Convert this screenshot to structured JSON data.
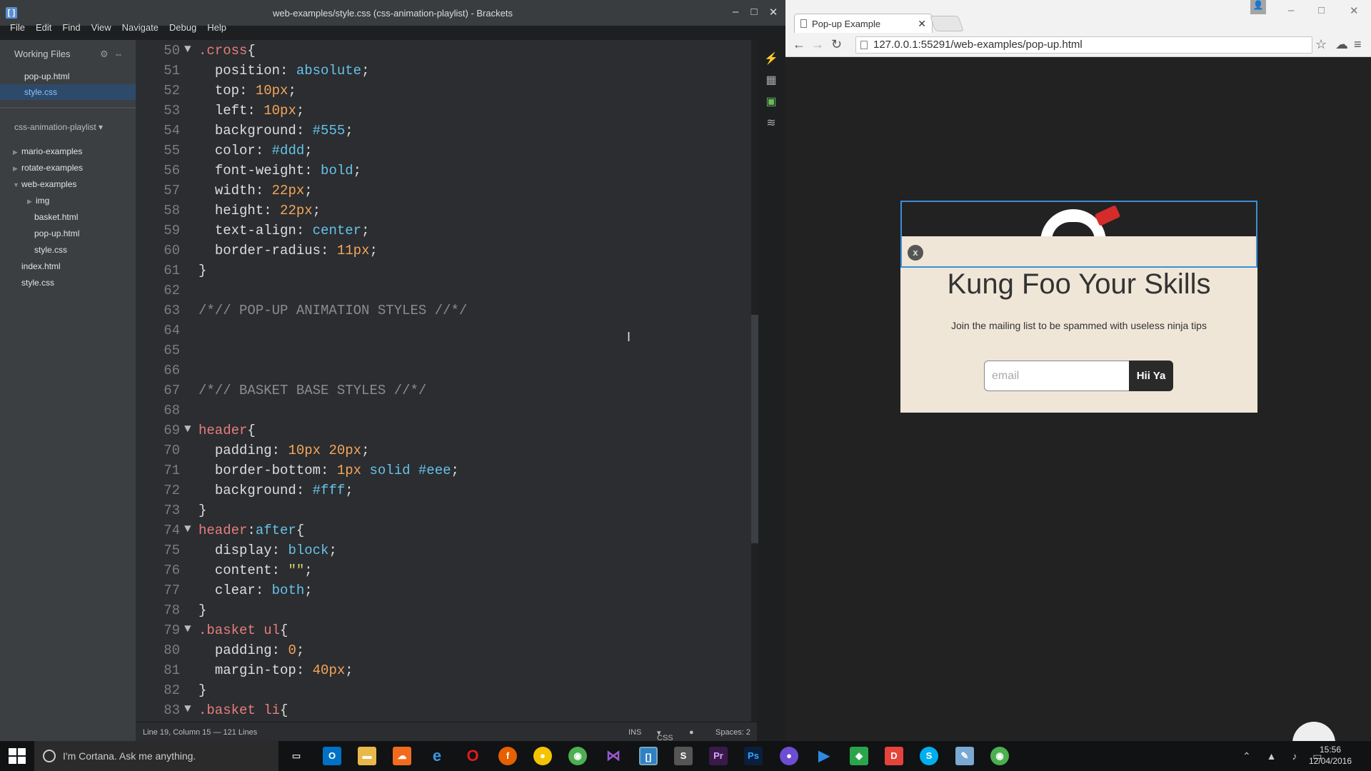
{
  "brackets": {
    "title": "web-examples/style.css (css-animation-playlist) - Brackets",
    "menu": [
      "File",
      "Edit",
      "Find",
      "View",
      "Navigate",
      "Debug",
      "Help"
    ],
    "working_files_title": "Working Files",
    "working_files": [
      "pop-up.html",
      "style.css"
    ],
    "project_title": "css-animation-playlist",
    "tree": [
      "mario-examples",
      "rotate-examples",
      "web-examples",
      "img",
      "basket.html",
      "pop-up.html",
      "style.css",
      "index.html",
      "style.css"
    ],
    "code_lines": [
      {
        "n": "50",
        "fold": "▼",
        "html": "<span class='sel-c'>.cross</span>{"
      },
      {
        "n": "51",
        "html": "  <span class='prop'>position</span>: <span class='val'>absolute</span>;"
      },
      {
        "n": "52",
        "html": "  <span class='prop'>top</span>: <span class='num'>10px</span>;"
      },
      {
        "n": "53",
        "html": "  <span class='prop'>left</span>: <span class='num'>10px</span>;"
      },
      {
        "n": "54",
        "html": "  <span class='prop'>background</span>: <span class='hash'>#555</span>;"
      },
      {
        "n": "55",
        "html": "  <span class='prop'>color</span>: <span class='hash'>#ddd</span>;"
      },
      {
        "n": "56",
        "html": "  <span class='prop'>font-weight</span>: <span class='val'>bold</span>;"
      },
      {
        "n": "57",
        "html": "  <span class='prop'>width</span>: <span class='num'>22px</span>;"
      },
      {
        "n": "58",
        "html": "  <span class='prop'>height</span>: <span class='num'>22px</span>;"
      },
      {
        "n": "59",
        "html": "  <span class='prop'>text-align</span>: <span class='val'>center</span>;"
      },
      {
        "n": "60",
        "html": "  <span class='prop'>border-radius</span>: <span class='num'>11px</span>;"
      },
      {
        "n": "61",
        "html": "}"
      },
      {
        "n": "62",
        "html": ""
      },
      {
        "n": "63",
        "html": "<span class='cmt'>/*// POP-UP ANIMATION STYLES //*/</span>"
      },
      {
        "n": "64",
        "html": ""
      },
      {
        "n": "65",
        "html": ""
      },
      {
        "n": "66",
        "html": ""
      },
      {
        "n": "67",
        "html": "<span class='cmt'>/*// BASKET BASE STYLES //*/</span>"
      },
      {
        "n": "68",
        "html": ""
      },
      {
        "n": "69",
        "fold": "▼",
        "html": "<span class='sel-c'>header</span>{"
      },
      {
        "n": "70",
        "html": "  <span class='prop'>padding</span>: <span class='num'>10px</span> <span class='num'>20px</span>;"
      },
      {
        "n": "71",
        "html": "  <span class='prop'>border-bottom</span>: <span class='num'>1px</span> <span class='val'>solid</span> <span class='hash'>#eee</span>;"
      },
      {
        "n": "72",
        "html": "  <span class='prop'>background</span>: <span class='hash'>#fff</span>;"
      },
      {
        "n": "73",
        "html": "}"
      },
      {
        "n": "74",
        "fold": "▼",
        "html": "<span class='sel-c'>header</span>:<span class='val'>after</span>{"
      },
      {
        "n": "75",
        "html": "  <span class='prop'>display</span>: <span class='val'>block</span>;"
      },
      {
        "n": "76",
        "html": "  <span class='prop'>content</span>: <span class='str'>\"\"</span>;"
      },
      {
        "n": "77",
        "html": "  <span class='prop'>clear</span>: <span class='val'>both</span>;"
      },
      {
        "n": "78",
        "html": "}"
      },
      {
        "n": "79",
        "fold": "▼",
        "html": "<span class='sel-c'>.basket ul</span>{"
      },
      {
        "n": "80",
        "html": "  <span class='prop'>padding</span>: <span class='num'>0</span>;"
      },
      {
        "n": "81",
        "html": "  <span class='prop'>margin-top</span>: <span class='num'>40px</span>;"
      },
      {
        "n": "82",
        "html": "}"
      },
      {
        "n": "83",
        "fold": "▼",
        "html": "<span class='sel-c'>.basket li</span>{"
      }
    ],
    "status": {
      "position": "Line 19, Column 15 — 121 Lines",
      "mode": "INS",
      "lang": "CSS",
      "spaces": "Spaces: 2"
    }
  },
  "chrome": {
    "tab_title": "Pop-up Example",
    "url": "127.0.0.1:55291/web-examples/pop-up.html",
    "popup": {
      "close": "x",
      "headline": "Kung Foo Your Skills",
      "sub": "Join the mailing list to be spammed with useless ninja tips",
      "placeholder": "email",
      "button": "Hii Ya"
    }
  },
  "taskbar": {
    "search": "I'm Cortana. Ask me anything.",
    "time": "15:56",
    "date": "12/04/2016"
  }
}
